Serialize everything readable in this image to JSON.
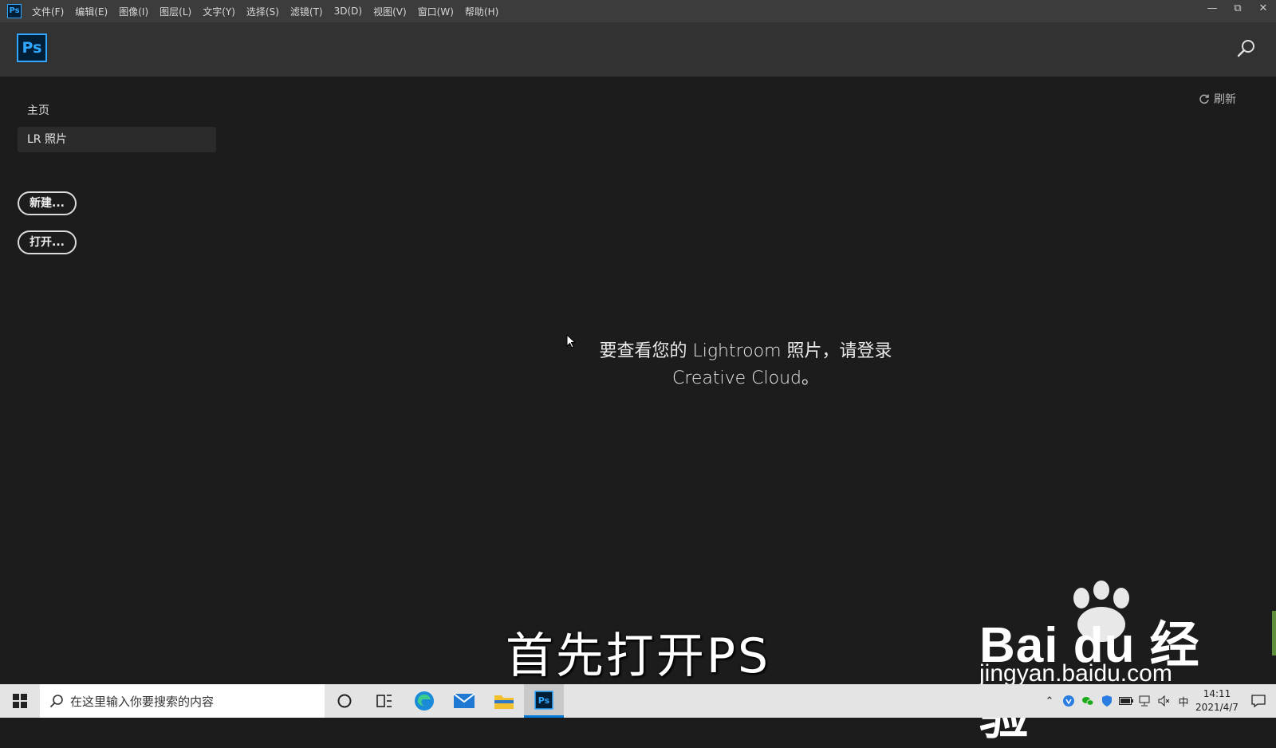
{
  "menubar": {
    "app_icon": "Ps",
    "items": [
      "文件(F)",
      "编辑(E)",
      "图像(I)",
      "图层(L)",
      "文字(Y)",
      "选择(S)",
      "滤镜(T)",
      "3D(D)",
      "视图(V)",
      "窗口(W)",
      "帮助(H)"
    ],
    "window_controls": [
      "minimize-icon",
      "restore-icon",
      "close-icon"
    ]
  },
  "header": {
    "logo": "Ps",
    "search_icon": "search-icon"
  },
  "sidebar": {
    "home_label": "主页",
    "lr_label": "LR 照片",
    "new_button": "新建...",
    "open_button": "打开..."
  },
  "main": {
    "refresh_label": "刷新",
    "message_line1": "要查看您的 Lightroom 照片，请登录",
    "message_line2": "Creative Cloud。"
  },
  "overlay": {
    "subtitle": "首先打开PS",
    "watermark_brand": "Bai du 经验",
    "watermark_site": "jingyan.baidu.com"
  },
  "taskbar": {
    "search_placeholder": "在这里输入你要搜索的内容",
    "ime": "中",
    "time": "14:11",
    "date": "2021/4/7"
  },
  "colors": {
    "ps_blue": "#31a8ff",
    "ps_navy": "#001e36",
    "background": "#1c1c1c",
    "taskbar": "#e4e4e4",
    "accent": "#0078d7"
  }
}
